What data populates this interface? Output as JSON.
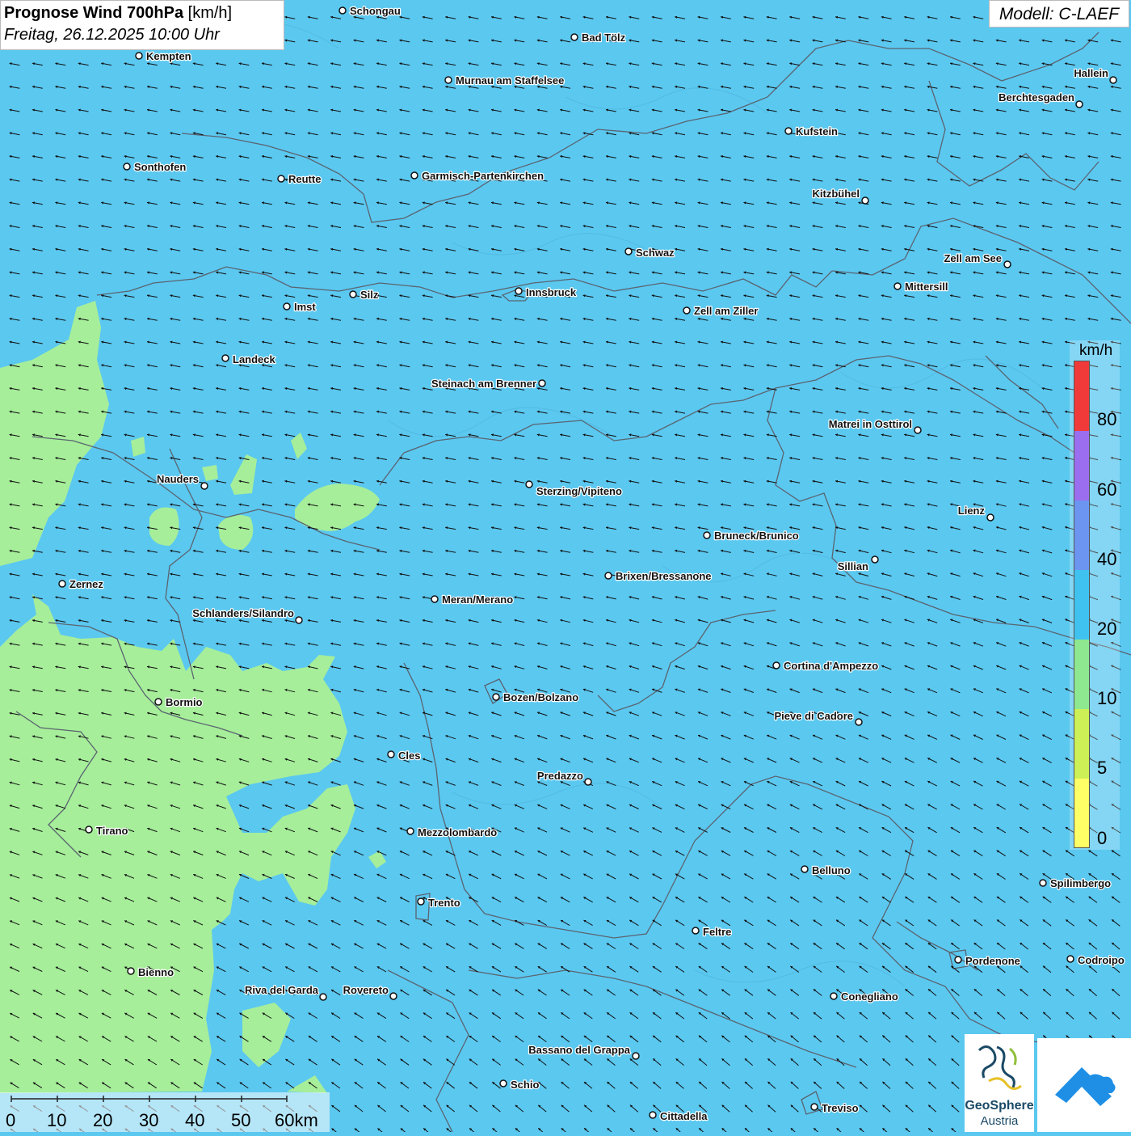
{
  "header": {
    "title_bold": "Prognose Wind 700hPa",
    "title_unit": "[km/h]",
    "subtitle": "Freitag, 26.12.2025 10:00 Uhr",
    "model": "Modell: C-LAEF"
  },
  "legend": {
    "unit": "km/h",
    "ticks": [
      "80",
      "60",
      "40",
      "20",
      "10",
      "5",
      "0"
    ],
    "colors": [
      "#ffff66",
      "#ccf055",
      "#8ee890",
      "#3fc2f0",
      "#6b95f0",
      "#9b6ef0",
      "#f03a3a"
    ]
  },
  "scale_bar": {
    "labels": [
      "0",
      "10",
      "20",
      "30",
      "40",
      "50",
      "60km"
    ]
  },
  "logos": {
    "geosphere_line1": "GeoSphere",
    "geosphere_line2": "Austria"
  },
  "map": {
    "wind_field": "light north-westerly flow, about 10-30 km/h",
    "colors": {
      "sea_blue": "#5bc8f0",
      "light_green": "#a6ee9a",
      "arrow": "#111111",
      "border": "#555555"
    },
    "cities": [
      {
        "name": "Schongau"
      },
      {
        "name": "Bad Tölz"
      },
      {
        "name": "Kempten"
      },
      {
        "name": "Murnau am Staffelsee"
      },
      {
        "name": "Hallein"
      },
      {
        "name": "Berchtesgaden"
      },
      {
        "name": "Kufstein"
      },
      {
        "name": "Sonthofen"
      },
      {
        "name": "Reutte"
      },
      {
        "name": "Garmisch-Partenkirchen"
      },
      {
        "name": "Kitzbühel"
      },
      {
        "name": "Schwaz"
      },
      {
        "name": "Zell am See"
      },
      {
        "name": "Mittersill"
      },
      {
        "name": "Silz"
      },
      {
        "name": "Innsbruck"
      },
      {
        "name": "Imst"
      },
      {
        "name": "Zell am Ziller"
      },
      {
        "name": "Landeck"
      },
      {
        "name": "Steinach am Brenner"
      },
      {
        "name": "Matrei in Osttirol"
      },
      {
        "name": "Nauders"
      },
      {
        "name": "Sterzing/Vipiteno"
      },
      {
        "name": "Lienz"
      },
      {
        "name": "Bruneck/Brunico"
      },
      {
        "name": "Sillian"
      },
      {
        "name": "Brixen/Bressanone"
      },
      {
        "name": "Zernez"
      },
      {
        "name": "Meran/Merano"
      },
      {
        "name": "Schlanders/Silandro"
      },
      {
        "name": "Cortina d'Ampezzo"
      },
      {
        "name": "Bozen/Bolzano"
      },
      {
        "name": "Bormio"
      },
      {
        "name": "Pieve di Cadore"
      },
      {
        "name": "Cles"
      },
      {
        "name": "Predazzo"
      },
      {
        "name": "Tirano"
      },
      {
        "name": "Mezzolombardo"
      },
      {
        "name": "Belluno"
      },
      {
        "name": "Spilimbergo"
      },
      {
        "name": "Trento"
      },
      {
        "name": "Feltre"
      },
      {
        "name": "Pordenone"
      },
      {
        "name": "Codroipo"
      },
      {
        "name": "Bienno"
      },
      {
        "name": "Riva del Garda"
      },
      {
        "name": "Rovereto"
      },
      {
        "name": "Conegliano"
      },
      {
        "name": "Bassano del Grappa"
      },
      {
        "name": "Schio"
      },
      {
        "name": "Treviso"
      },
      {
        "name": "Cittadella"
      }
    ]
  }
}
